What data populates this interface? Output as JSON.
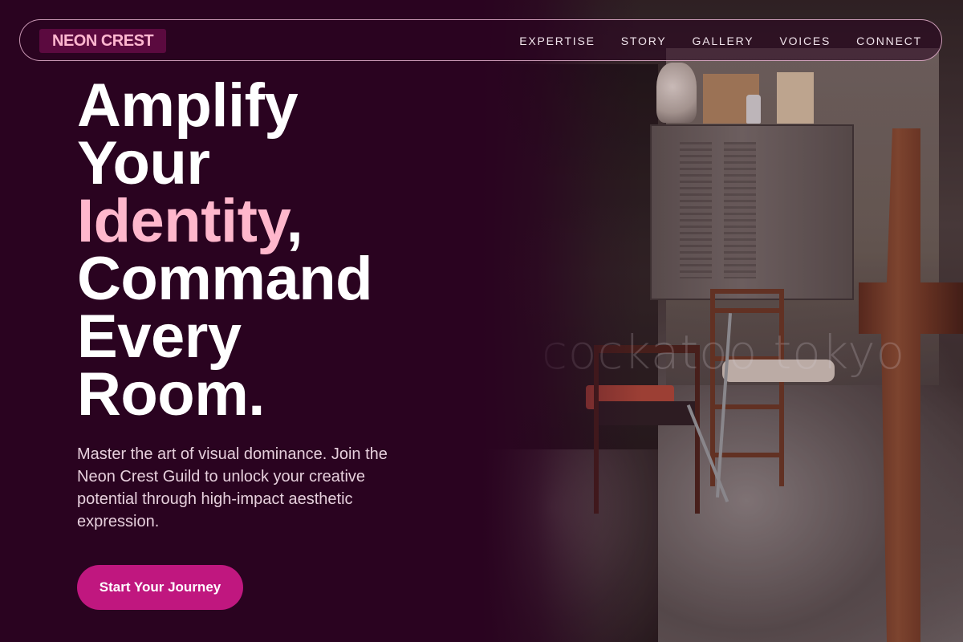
{
  "brand": {
    "name": "NEON CREST"
  },
  "nav": {
    "links": [
      "EXPERTISE",
      "STORY",
      "GALLERY",
      "VOICES",
      "CONNECT"
    ]
  },
  "hero": {
    "headline": {
      "line1": "Amplify",
      "line2": "Your",
      "line3_highlight": "Identity",
      "line3_suffix": ",",
      "line4": "Command",
      "line5": "Every",
      "line6": "Room."
    },
    "subtitle": "Master the art of visual dominance. Join the Neon Crest Guild to unlock your creative potential through high-impact aesthetic expression.",
    "cta_label": "Start Your Journey",
    "image_watermark": "cockatoo tokyo"
  },
  "colors": {
    "background": "#2a0320",
    "accent_pink": "#ffb7cc",
    "cta": "#c0177f",
    "brand_bg": "#5b0a3f"
  }
}
